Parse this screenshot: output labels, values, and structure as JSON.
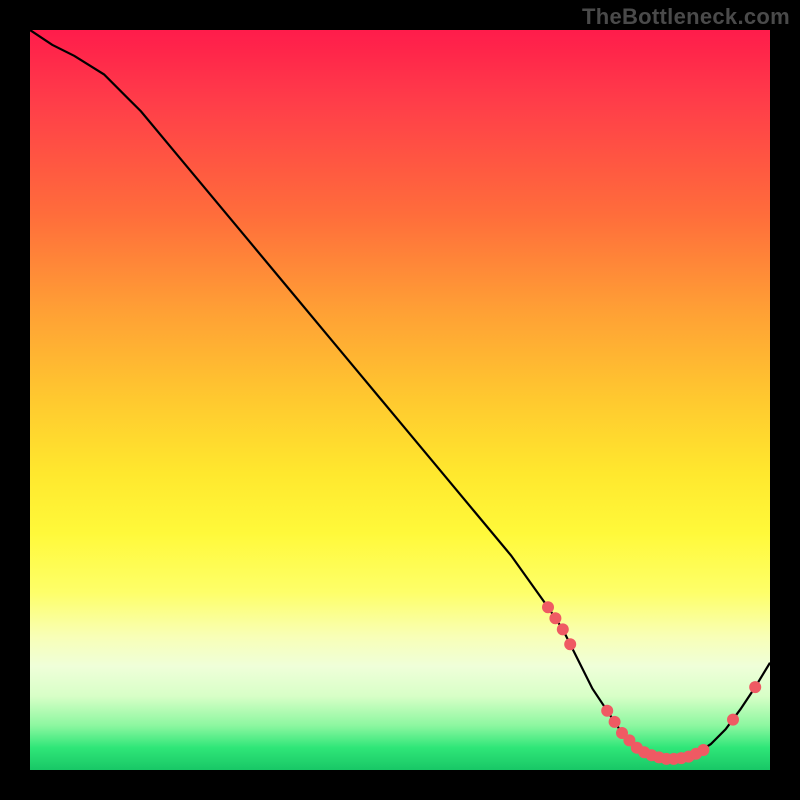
{
  "watermark": "TheBottleneck.com",
  "chart_data": {
    "type": "line",
    "title": "",
    "xlabel": "",
    "ylabel": "",
    "xlim": [
      0,
      100
    ],
    "ylim": [
      0,
      100
    ],
    "series": [
      {
        "name": "curve",
        "x": [
          0,
          3,
          6,
          10,
          15,
          20,
          25,
          30,
          35,
          40,
          45,
          50,
          55,
          60,
          65,
          70,
          72,
          74,
          76,
          78,
          80,
          82,
          84,
          86,
          88,
          90,
          92,
          94,
          96,
          98,
          100
        ],
        "y": [
          100,
          98,
          96.5,
          94,
          89,
          83,
          77,
          71,
          65,
          59,
          53,
          47,
          41,
          35,
          29,
          22,
          19,
          15,
          11,
          8,
          5,
          3,
          2,
          1.5,
          1.6,
          2.2,
          3.5,
          5.5,
          8.2,
          11.2,
          14.5
        ]
      }
    ],
    "markers": {
      "name": "marked-points",
      "color": "#ef5a63",
      "x": [
        70,
        71,
        72,
        73,
        78,
        79,
        80,
        81,
        82,
        83,
        84,
        85,
        86,
        87,
        88,
        89,
        90,
        91,
        95,
        98
      ],
      "y": [
        22,
        20.5,
        19,
        17,
        8,
        6.5,
        5,
        4,
        3,
        2.4,
        2,
        1.7,
        1.5,
        1.5,
        1.6,
        1.8,
        2.2,
        2.7,
        6.8,
        11.2
      ]
    }
  }
}
